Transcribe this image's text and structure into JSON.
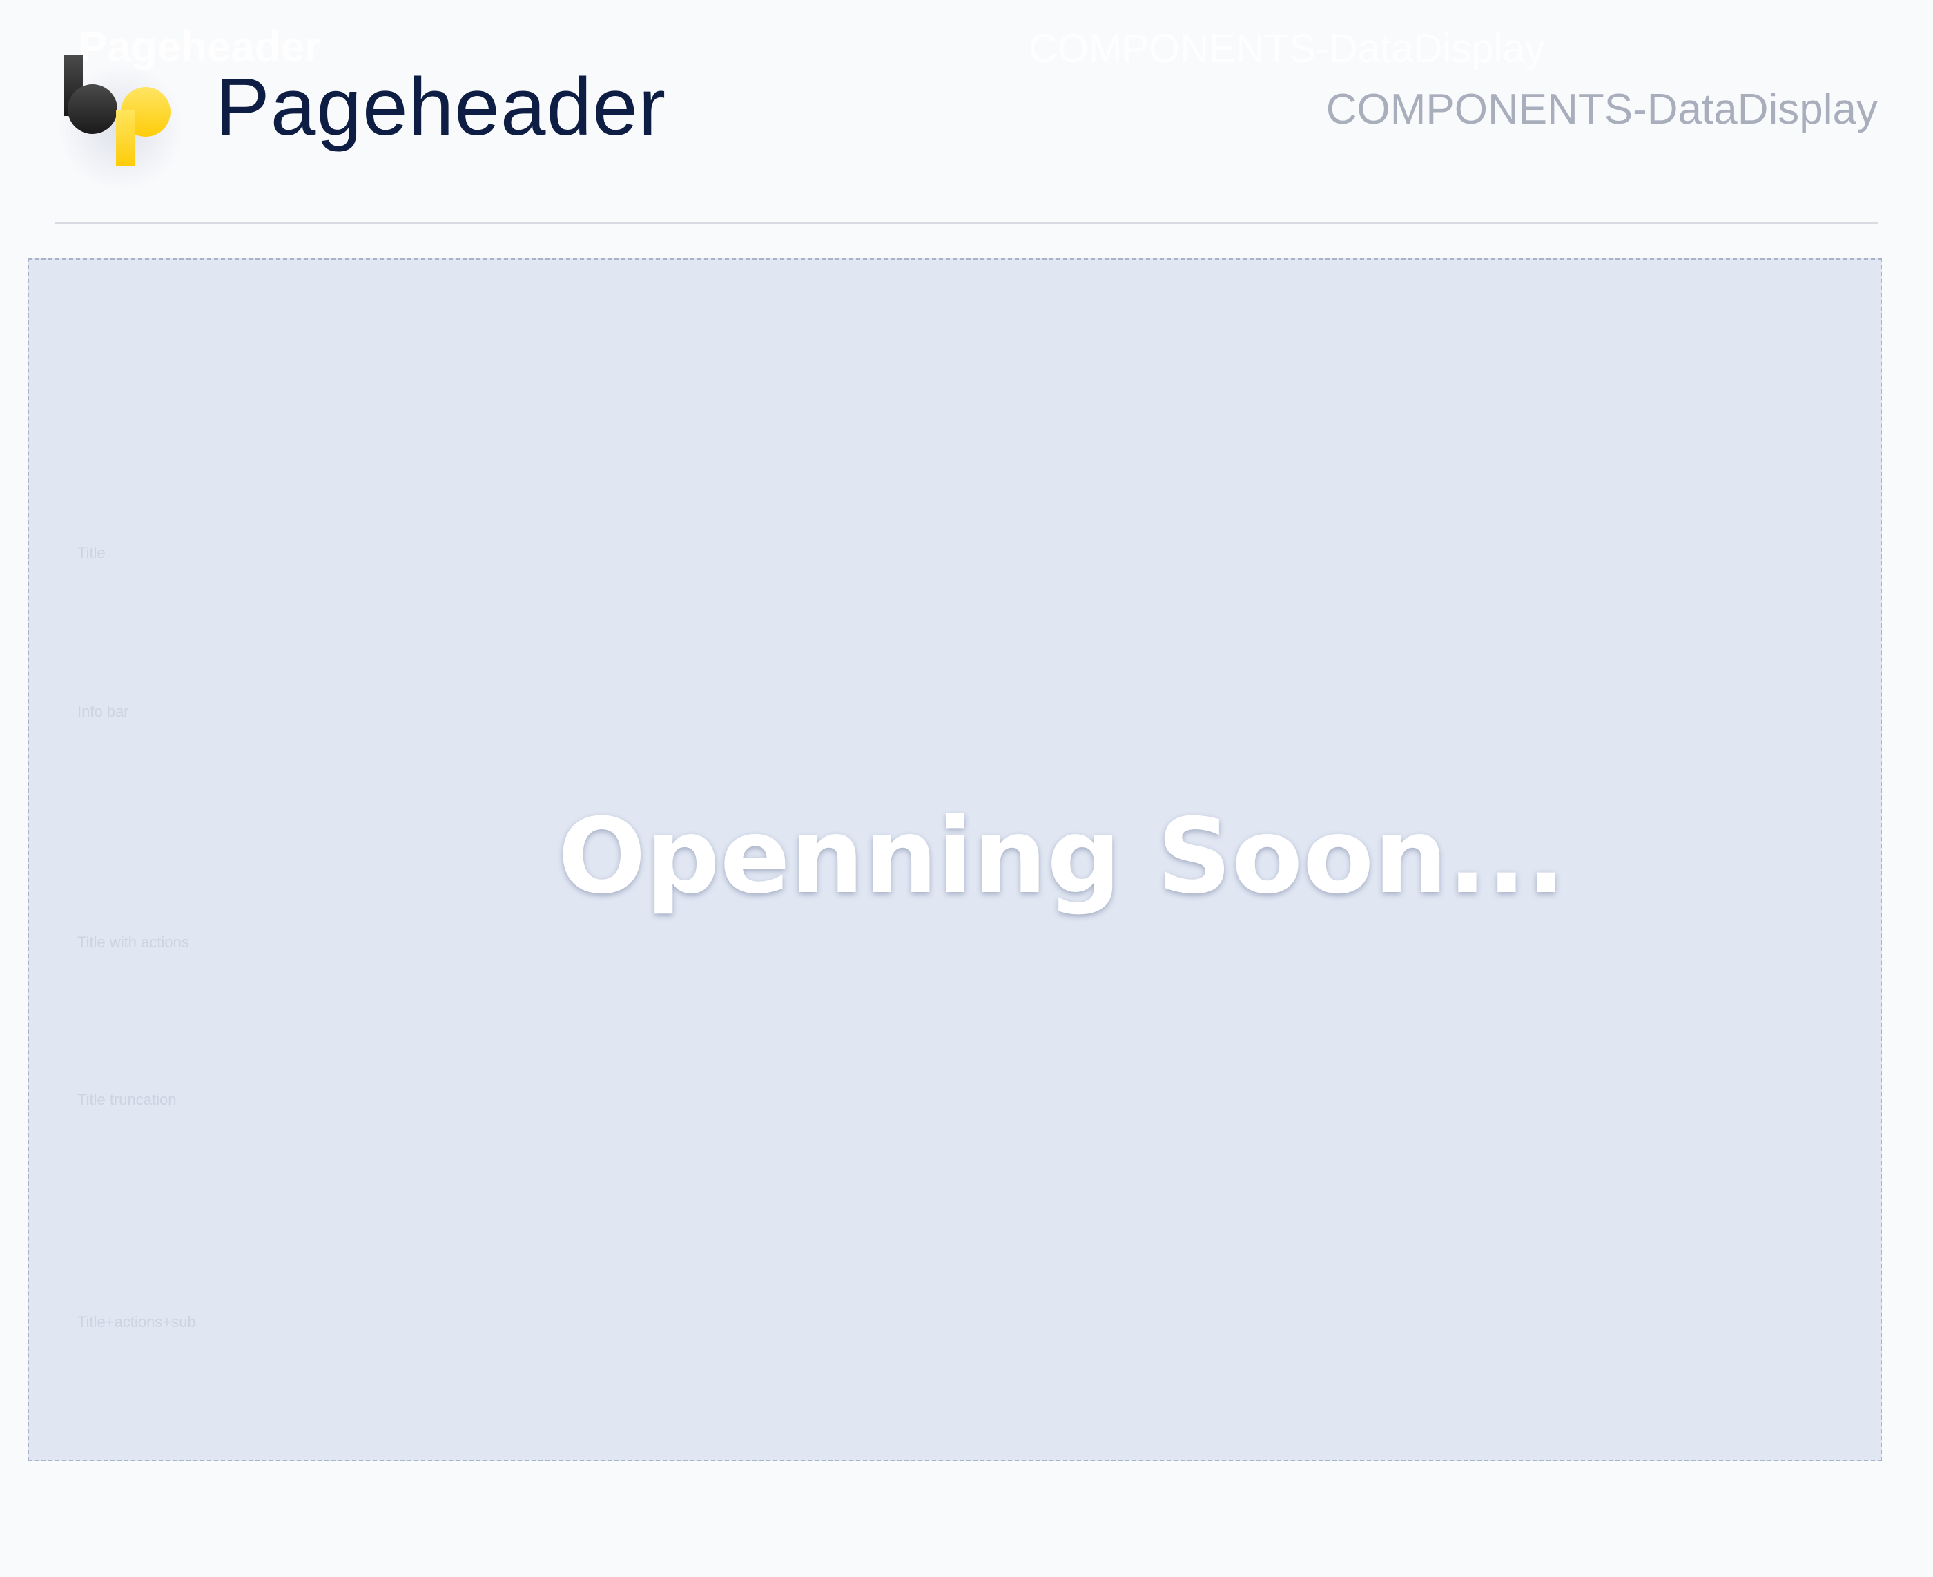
{
  "header": {
    "title": "Pageheader",
    "category": "COMPONENTS-DataDisplay"
  },
  "canvas": {
    "message": "Openning Soon...",
    "sections": [
      {
        "label": "Title"
      },
      {
        "label": "Info bar"
      },
      {
        "label": "Title with actions"
      },
      {
        "label": "Title truncation"
      },
      {
        "label": "Title+actions+sub"
      }
    ]
  },
  "colors": {
    "background": "#f9fafc",
    "title": "#0e1d43",
    "category": "#a9aebc",
    "canvas_fill": "#e0e6f2",
    "canvas_border": "#a9b2c7",
    "logo_dark": "#2b2b2b",
    "logo_yellow": "#ffd11a"
  },
  "icons": {
    "logo": "bp-logo-icon"
  }
}
